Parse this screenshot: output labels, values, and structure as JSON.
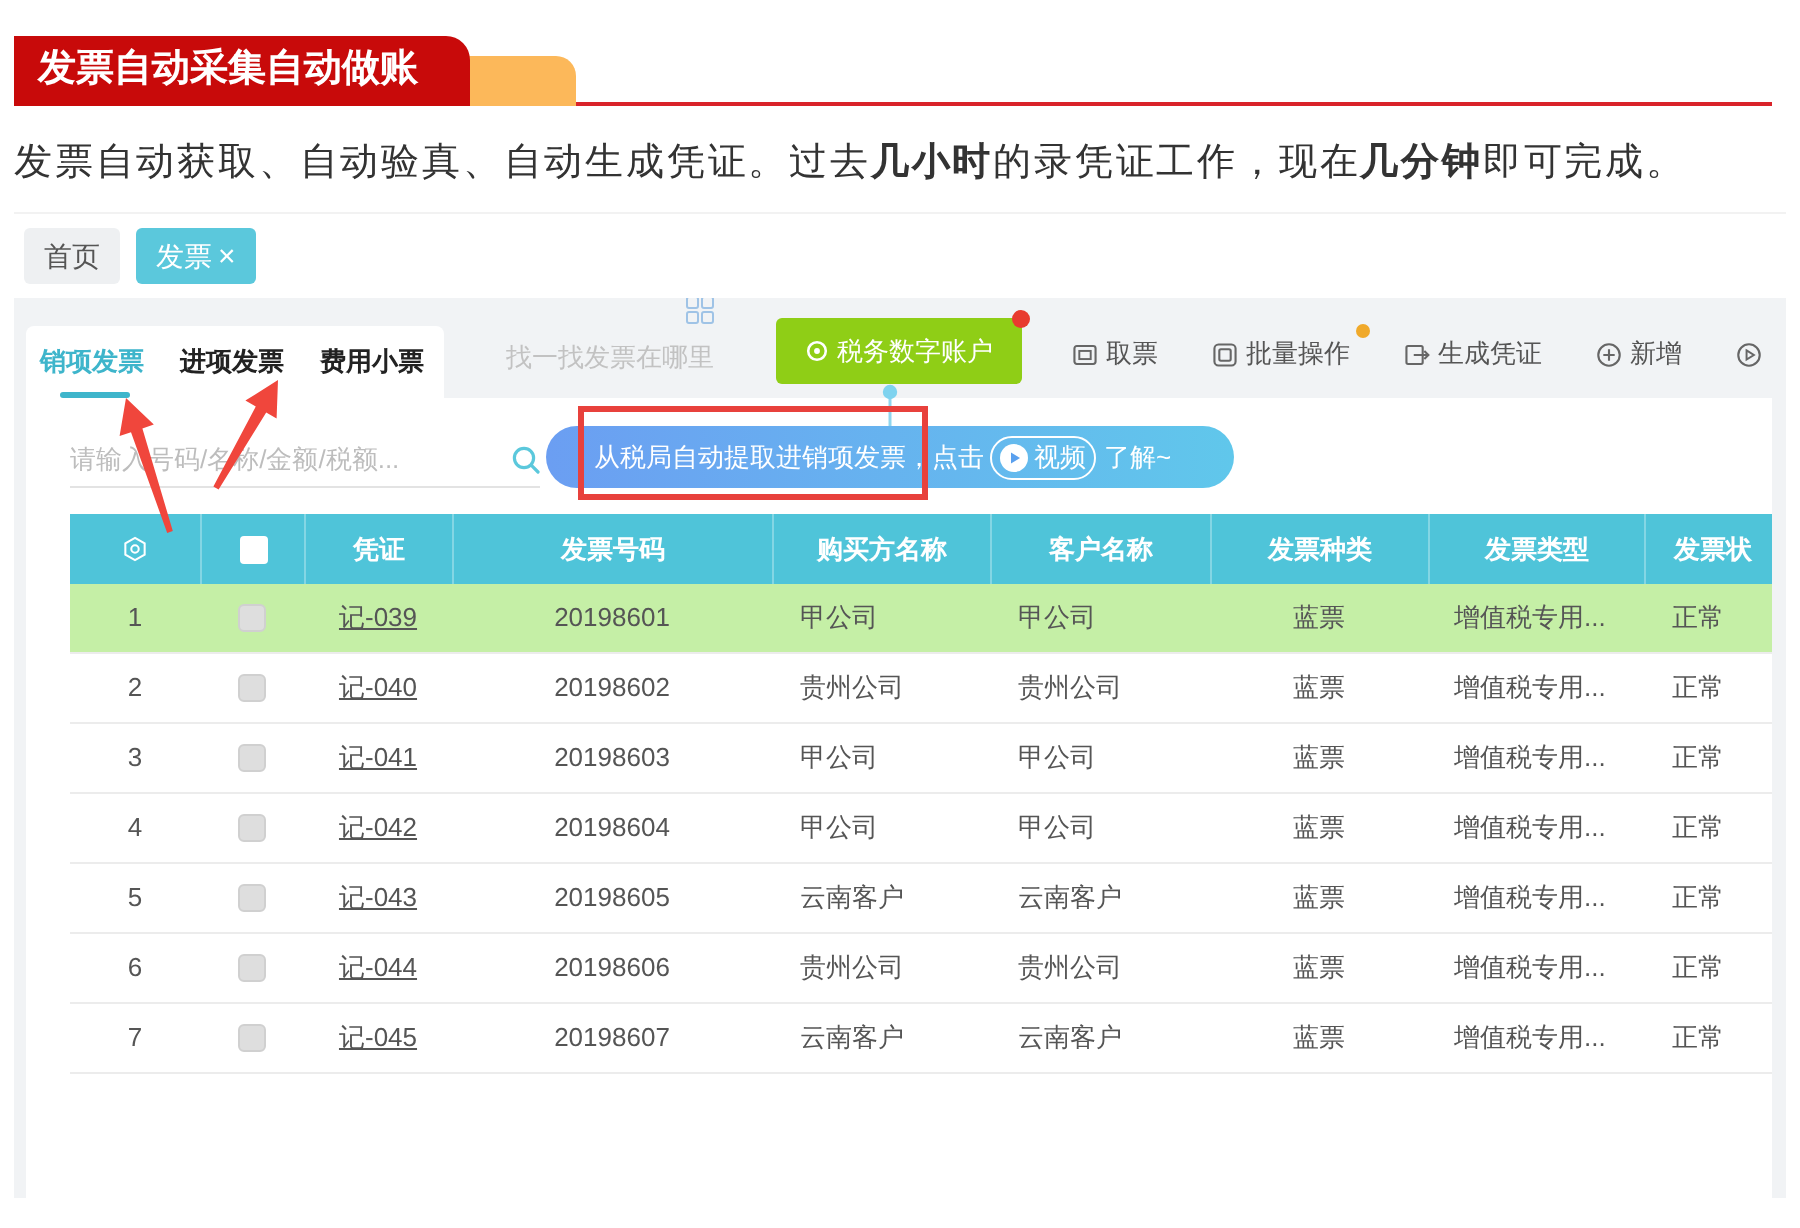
{
  "section_header": {
    "title": "发票自动采集自动做账"
  },
  "description": "发票自动获取、自动验真、自动生成凭证。过去**几小时**的录凭证工作，现在**几分钟**即可完成。",
  "page_tabs": [
    {
      "label": "首页",
      "selected": false
    },
    {
      "label": "发票",
      "selected": true,
      "close": "×"
    }
  ],
  "invoice_tabs": [
    {
      "label": "销项发票",
      "selected": true
    },
    {
      "label": "进项发票",
      "selected": false
    },
    {
      "label": "费用小票",
      "selected": false
    }
  ],
  "help_link": {
    "label": "找一找发票在哪里"
  },
  "account_button": {
    "label": "税务数字账户",
    "alert_dot": true
  },
  "toolbar": [
    {
      "kind": "labeled",
      "label": "取票",
      "alert_dot": false
    },
    {
      "kind": "labeled",
      "label": "批量操作",
      "alert_dot": true
    },
    {
      "kind": "labeled",
      "label": "生成凭证",
      "alert_dot": false
    },
    {
      "kind": "labeled",
      "label": "新增",
      "alert_dot": false
    },
    {
      "kind": "icon_only",
      "alert_dot": false
    }
  ],
  "search": {
    "placeholder": "请输入号码/名称/金额/税额..."
  },
  "tooltip": {
    "text": "从税局自动提取进销项发票，点击",
    "video_button": "视频",
    "suffix": "了解~"
  },
  "table": {
    "header_checkbox": {
      "checked": false
    },
    "columns": [
      "凭证",
      "发票号码",
      "购买方名称",
      "客户名称",
      "发票种类",
      "发票类型",
      "发票状"
    ],
    "rows": [
      {
        "number": "1",
        "checked": false,
        "selected": true,
        "cells": [
          "记-039",
          "20198601",
          "甲公司",
          "甲公司",
          "蓝票",
          "增值税专用...",
          "正常"
        ]
      },
      {
        "number": "2",
        "checked": false,
        "selected": false,
        "cells": [
          "记-040",
          "20198602",
          "贵州公司",
          "贵州公司",
          "蓝票",
          "增值税专用...",
          "正常"
        ]
      },
      {
        "number": "3",
        "checked": false,
        "selected": false,
        "cells": [
          "记-041",
          "20198603",
          "甲公司",
          "甲公司",
          "蓝票",
          "增值税专用...",
          "正常"
        ]
      },
      {
        "number": "4",
        "checked": false,
        "selected": false,
        "cells": [
          "记-042",
          "20198604",
          "甲公司",
          "甲公司",
          "蓝票",
          "增值税专用...",
          "正常"
        ]
      },
      {
        "number": "5",
        "checked": false,
        "selected": false,
        "cells": [
          "记-043",
          "20198605",
          "云南客户",
          "云南客户",
          "蓝票",
          "增值税专用...",
          "正常"
        ]
      },
      {
        "number": "6",
        "checked": false,
        "selected": false,
        "cells": [
          "记-044",
          "20198606",
          "贵州公司",
          "贵州公司",
          "蓝票",
          "增值税专用...",
          "正常"
        ]
      },
      {
        "number": "7",
        "checked": false,
        "selected": false,
        "cells": [
          "记-045",
          "20198607",
          "云南客户",
          "云南客户",
          "蓝票",
          "增值税专用...",
          "正常"
        ]
      }
    ]
  },
  "annotations": [
    {
      "kind": "arrow"
    },
    {
      "kind": "arrow"
    },
    {
      "kind": "highlight_box"
    }
  ]
}
